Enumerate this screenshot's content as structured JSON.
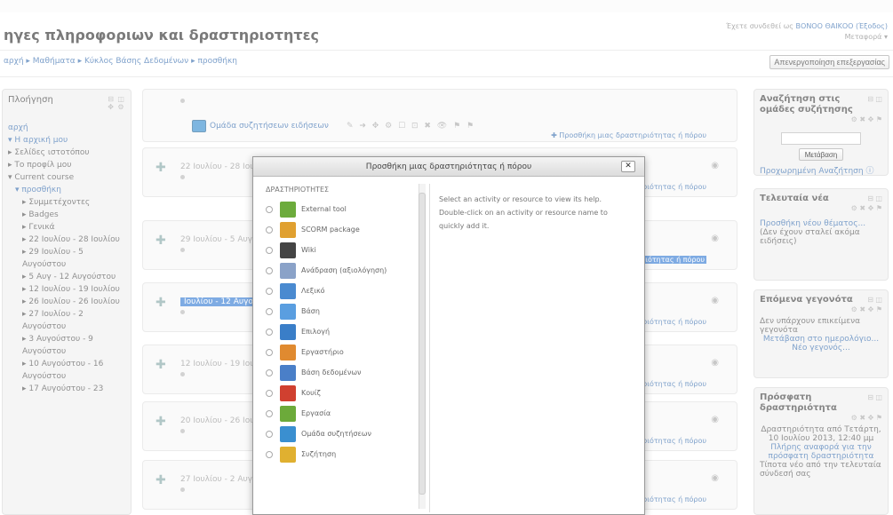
{
  "header": {
    "title": "ηγες πληροφοριων και δραστηριοτητες",
    "login_text": "Έχετε συνδεθεί ως ",
    "login_name": "ΒΟΝΟΟ ΘΑΙΚΟΟ (Έξοδος)",
    "role_switch": "Μεταφορά ▾",
    "breadcrumb": "αρχή ▸ Μαθήματα ▸ Κύκλος Βάσης Δεδομένων ▸ προσθήκη",
    "edit_off_button": "Απενεργοποίηση επεξεργασίας"
  },
  "navigation": {
    "title": "Πλοήγηση",
    "items": [
      {
        "label": "αρχή",
        "link": true,
        "indent": 0
      },
      {
        "label": "▾ Η αρχική μου",
        "link": true,
        "indent": 0
      },
      {
        "label": "▸ Σελίδες ιστοτόπου",
        "link": false,
        "indent": 0
      },
      {
        "label": "▸ Το προφίλ μου",
        "link": false,
        "indent": 0
      },
      {
        "label": "▾ Current course",
        "link": false,
        "indent": 0
      },
      {
        "label": "▾ προσθήκη",
        "link": true,
        "indent": 1
      },
      {
        "label": "▸ Συμμετέχοντες",
        "link": false,
        "indent": 2
      },
      {
        "label": "▸ Badges",
        "link": false,
        "indent": 2
      },
      {
        "label": "▸ Γενικά",
        "link": false,
        "indent": 2
      },
      {
        "label": "▸ 22 Ιουλίου - 28 Ιουλίου",
        "link": false,
        "indent": 2
      },
      {
        "label": "▸ 29 Ιουλίου - 5 Αυγούστου",
        "link": false,
        "indent": 2
      },
      {
        "label": "▸ 5 Αυγ - 12 Αυγούστου",
        "link": false,
        "indent": 2
      },
      {
        "label": "▸ 12 Ιουλίου - 19 Ιουλίου",
        "link": false,
        "indent": 2
      },
      {
        "label": "▸ 26 Ιουλίου - 26 Ιουλίου",
        "link": false,
        "indent": 2
      },
      {
        "label": "▸ 27 Ιουλίου - 2 Αυγούστου",
        "link": false,
        "indent": 2
      },
      {
        "label": "▸ 3 Αυγούστου - 9 Αυγούστου",
        "link": false,
        "indent": 2
      },
      {
        "label": "▸ 10 Αυγούστου - 16 Αυγούστου",
        "link": false,
        "indent": 2
      },
      {
        "label": "▸ 17 Αυγούστου - 23",
        "link": false,
        "indent": 2
      }
    ]
  },
  "section0": {
    "forum_label": "Ομάδα συζητήσεων ειδήσεων",
    "add_label": "✚ Προσθήκη μιας δραστηριότητας ή πόρου"
  },
  "weeks": [
    {
      "title": "22 Ιουλίου - 28 Ιουλίου",
      "add": "Προσθήκη μιας δραστηριότητας ή πόρου",
      "highlight": false,
      "add_selected": false
    },
    {
      "title": "29 Ιουλίου - 5 Αυγούστου",
      "add": "Προσθήκη μιας δραστηριότητας ή πόρου",
      "highlight": false,
      "add_selected": true
    },
    {
      "title": "Ιουλίου - 12 Αυγούστου",
      "add": "Προσθήκη μιας δραστηριότητας ή πόρου",
      "highlight": true,
      "add_selected": false
    },
    {
      "title": "12 Ιουλίου - 19 Ιουλίου",
      "add": "Προσθήκη μιας δραστηριότητας ή πόρου",
      "highlight": false,
      "add_selected": false
    },
    {
      "title": "20 Ιουλίου - 26 Ιουλίου",
      "add": "Προσθήκη μιας δραστηριότητας ή πόρου",
      "highlight": false,
      "add_selected": false
    },
    {
      "title": "27 Ιουλίου - 2 Αυγούστου",
      "add": "Προσθήκη μιας δραστηριότητας ή πόρου",
      "highlight": false,
      "add_selected": false
    }
  ],
  "right": {
    "search_title": "Αναζήτηση στις ομάδες συζήτησης",
    "search_button": "Μετάβαση",
    "advanced_search": "Προχωρημένη Αναζήτηση",
    "news_title": "Τελευταία νέα",
    "news_text": "Προσθήκη νέου θέματος...",
    "news_note": "(Δεν έχουν σταλεί ακόμα ειδήσεις)",
    "upcoming_title": "Επόμενα γεγονότα",
    "upcoming_text": "Δεν υπάρχουν επικείμενα γεγονότα",
    "upcoming_link": "Μετάβαση στο ημερολόγιο...",
    "upcoming_new": "Νέο γεγονός...",
    "recent_title": "Πρόσφατη δραστηριότητα",
    "recent_text": "Δραστηριότητα από Τετάρτη, 10 Ιουλίου 2013, 12:40 μμ",
    "recent_link": "Πλήρης αναφορά για την πρόσφατη δραστηριότητα",
    "recent_more": "Τίποτα νέο από την τελευταία σύνδεσή σας"
  },
  "dialog": {
    "title": "Προσθήκη μιας δραστηριότητας ή πόρου",
    "close": "✕",
    "section_header": "ΔΡΑΣΤΗΡΙΟΤΗΤΕΣ",
    "help_1": "Select an activity or resource to view its help.",
    "help_2": "Double-click on an activity or resource name to quickly add it.",
    "options": [
      {
        "label": "External tool",
        "icon": "puzzle-icon",
        "color": "#6cab3c"
      },
      {
        "label": "SCORM package",
        "icon": "scorm-icon",
        "color": "#e0a030"
      },
      {
        "label": "Wiki",
        "icon": "wiki-icon",
        "color": "#444444"
      },
      {
        "label": "Ανάδραση (αξιολόγηση)",
        "icon": "feedback-icon",
        "color": "#8aa2c8"
      },
      {
        "label": "Λεξικό",
        "icon": "glossary-icon",
        "color": "#4a8ad0"
      },
      {
        "label": "Βάση",
        "icon": "database-icon",
        "color": "#5a9ee0"
      },
      {
        "label": "Επιλογή",
        "icon": "choice-icon",
        "color": "#3a7ec8"
      },
      {
        "label": "Εργαστήριο",
        "icon": "workshop-icon",
        "color": "#e08a30"
      },
      {
        "label": "Βάση δεδομένων",
        "icon": "db-icon",
        "color": "#4a7fc8"
      },
      {
        "label": "Κουίζ",
        "icon": "quiz-icon",
        "color": "#d04030"
      },
      {
        "label": "Εργασία",
        "icon": "assignment-icon",
        "color": "#6caa3a"
      },
      {
        "label": "Ομάδα συζητήσεων",
        "icon": "forum-icon",
        "color": "#3a8fd0"
      },
      {
        "label": "Συζήτηση",
        "icon": "chat-icon",
        "color": "#e0b030"
      }
    ]
  }
}
